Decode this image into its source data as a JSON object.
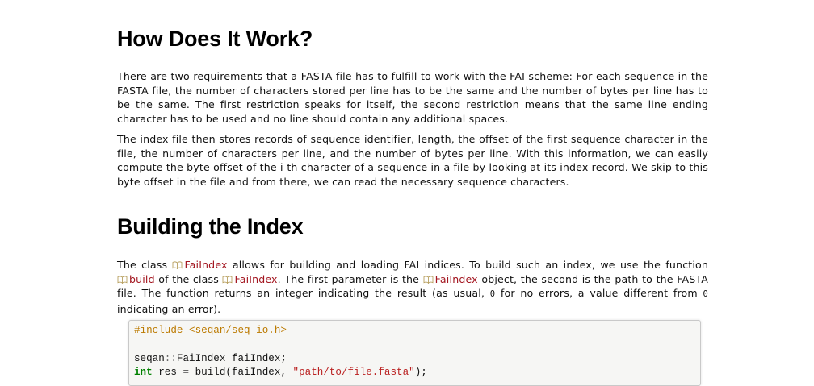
{
  "sections": [
    {
      "heading": "How Does It Work?",
      "paragraphs": [
        "There are two requirements that a FASTA file has to fulfill to work with the FAI scheme: For each sequence in the FASTA file, the number of characters stored per line has to be the same and the number of bytes per line has to be the same. The first restriction speaks for itself, the second restriction means that the same line ending character has to be used and no line should contain any additional spaces.",
        "The index file then stores records of sequence identifier, length, the offset of the first sequence character in the file, the number of characters per line, and the number of bytes per line. With this information, we can easily compute the byte offset of the i-th character of a sequence in a file by looking at its index record. We skip to this byte offset in the file and from there, we can read the necessary sequence characters."
      ]
    },
    {
      "heading": "Building the Index",
      "paragraph_parts": {
        "t1": "The class ",
        "ref_faiindex": "FaiIndex",
        "t2": " allows for building and loading FAI indices. To build such an index, we use the function ",
        "ref_build": "build",
        "t3": " of the class ",
        "t4": ". The first parameter is the ",
        "t5": " object, the second is the path to the FASTA file. The function returns an integer indicating the result (as usual, ",
        "code_zero": "0",
        "t6": " for no errors, a value different from ",
        "t7": " indicating an error)."
      }
    }
  ],
  "code": {
    "line1_directive": "#include",
    "line1_header": "<seqan/seq_io.h>",
    "line2_ns": "seqan",
    "line2_sep": "::",
    "line2_rest": "FaiIndex faiIndex;",
    "line3_kw": "int",
    "line3_partial_a": " res ",
    "line3_eq": "=",
    "line3_partial_b": " build(faiIndex, ",
    "line3_str": "\"path/to/file.fasta\"",
    "line3_end": ");"
  },
  "icons": {
    "doc_ref": "book-icon"
  },
  "colors": {
    "link": "#a3151f",
    "code_bg": "#f6f6f4",
    "preprocessor": "#bc7a00"
  }
}
